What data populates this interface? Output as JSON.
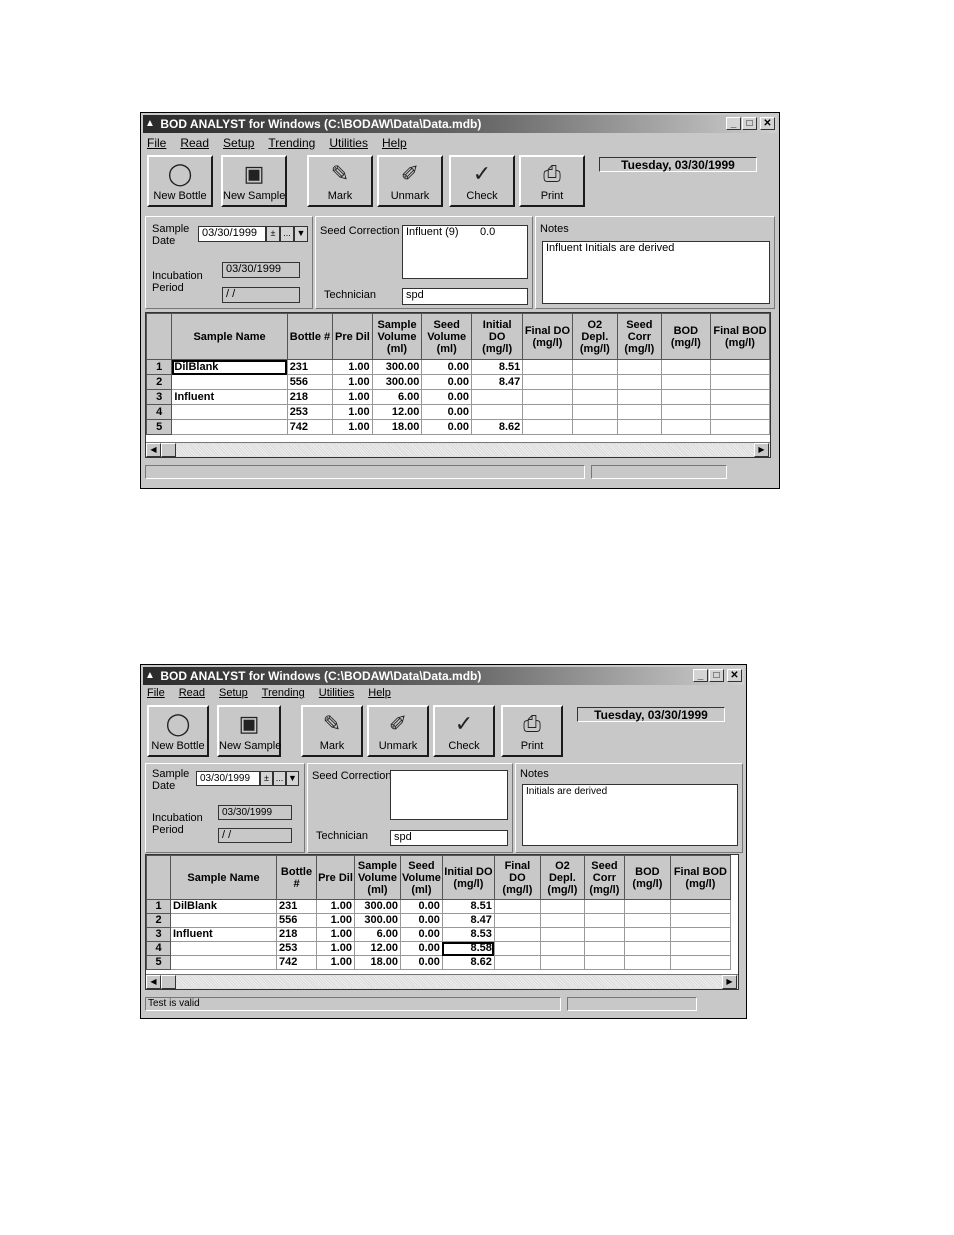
{
  "window_title": "BOD ANALYST for Windows (C:\\BODAW\\Data\\Data.mdb)",
  "title_icon": "bottle-icon",
  "controls": {
    "minimize": "_",
    "maximize": "□",
    "close": "✕"
  },
  "menu": [
    "File",
    "Read",
    "Setup",
    "Trending",
    "Utilities",
    "Help"
  ],
  "toolbar": {
    "new_bottle": "New Bottle",
    "new_sample": "New Sample",
    "mark": "Mark",
    "unmark": "Unmark",
    "check": "Check",
    "print": "Print",
    "date_display": "Tuesday, 03/30/1999"
  },
  "form": {
    "sample_date_label": "Sample Date",
    "sample_date": "03/30/1999",
    "incubation_label": "Incubation Period",
    "incubation_start": "03/30/1999",
    "incubation_end": " /  /",
    "seed_correction_label": "Seed Correction",
    "technician_label": "Technician",
    "technician": "spd",
    "notes_label": "Notes"
  },
  "columns": [
    "",
    "Sample Name",
    "Bottle #",
    "Pre Dil",
    "Sample Volume (ml)",
    "Seed Volume (ml)",
    "Initial DO (mg/l)",
    "Final DO (mg/l)",
    "O2 Depl. (mg/l)",
    "Seed Corr (mg/l)",
    "BOD (mg/l)",
    "Final BOD (mg/l)"
  ],
  "screens": [
    {
      "seed_correction_value": "Influent (9)       0.0",
      "notes": "Influent Initials are derived",
      "status_left": "",
      "status_right": "",
      "rows": [
        [
          "1",
          "DilBlank",
          "231",
          "1.00",
          "300.00",
          "0.00",
          "8.51",
          "",
          "",
          "",
          "",
          ""
        ],
        [
          "2",
          "",
          "556",
          "1.00",
          "300.00",
          "0.00",
          "8.47",
          "",
          "",
          "",
          "",
          ""
        ],
        [
          "3",
          "Influent",
          "218",
          "1.00",
          "6.00",
          "0.00",
          "",
          "",
          "",
          "",
          "",
          ""
        ],
        [
          "4",
          "",
          "253",
          "1.00",
          "12.00",
          "0.00",
          "",
          "",
          "",
          "",
          "",
          ""
        ],
        [
          "5",
          "",
          "742",
          "1.00",
          "18.00",
          "0.00",
          "8.62",
          "",
          "",
          "",
          "",
          ""
        ]
      ]
    },
    {
      "seed_correction_value": "",
      "notes": "Initials are derived",
      "status_left": "Test is valid",
      "status_right": "",
      "rows": [
        [
          "1",
          "DilBlank",
          "231",
          "1.00",
          "300.00",
          "0.00",
          "8.51",
          "",
          "",
          "",
          "",
          ""
        ],
        [
          "2",
          "",
          "556",
          "1.00",
          "300.00",
          "0.00",
          "8.47",
          "",
          "",
          "",
          "",
          ""
        ],
        [
          "3",
          "Influent",
          "218",
          "1.00",
          "6.00",
          "0.00",
          "8.53",
          "",
          "",
          "",
          "",
          ""
        ],
        [
          "4",
          "",
          "253",
          "1.00",
          "12.00",
          "0.00",
          "8.58",
          "",
          "",
          "",
          "",
          ""
        ],
        [
          "5",
          "",
          "742",
          "1.00",
          "18.00",
          "0.00",
          "8.62",
          "",
          "",
          "",
          "",
          ""
        ]
      ]
    }
  ]
}
